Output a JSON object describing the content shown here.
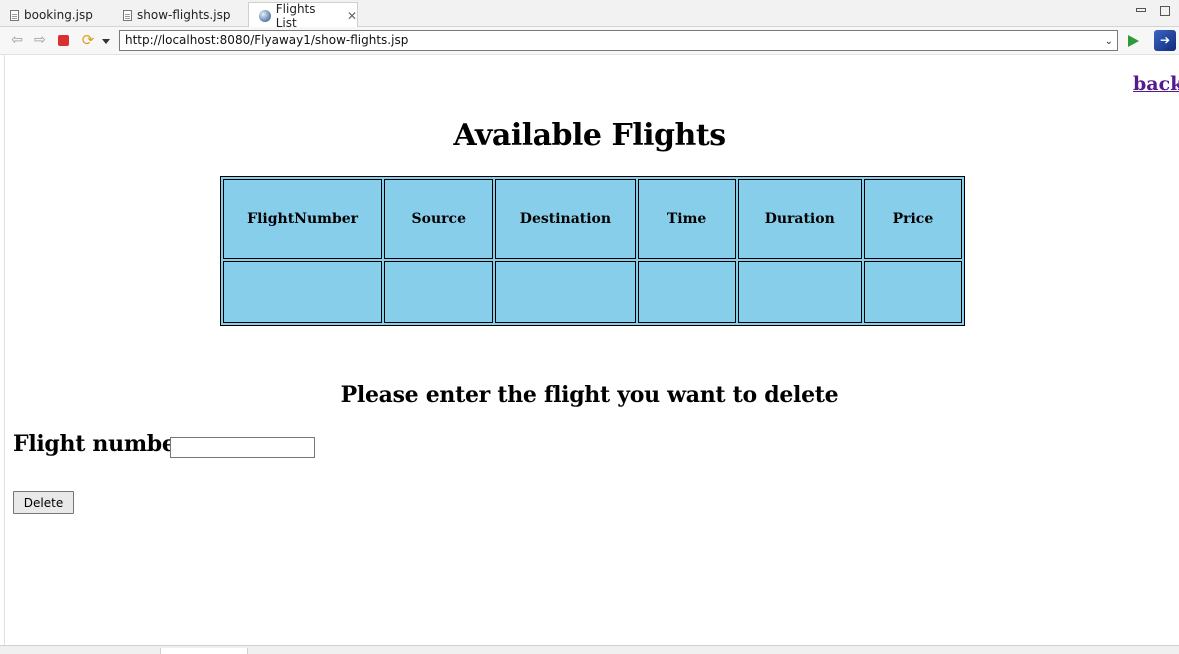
{
  "tabs": [
    {
      "label": "booking.jsp",
      "icon": "file-icon"
    },
    {
      "label": "show-flights.jsp",
      "icon": "file-icon"
    },
    {
      "label": "Flights List",
      "icon": "globe-icon",
      "active": true
    }
  ],
  "toolbar": {
    "url": "http://localhost:8080/Flyaway1/show-flights.jsp"
  },
  "page": {
    "back_link": "back",
    "title": "Available Flights",
    "table": {
      "headers": [
        "FlightNumber",
        "Source",
        "Destination",
        "Time",
        "Duration",
        "Price"
      ],
      "rows": [
        [
          "",
          "",
          "",
          "",
          "",
          ""
        ]
      ]
    },
    "delete_heading": "Please enter the flight you want to delete",
    "flight_label": "Flight number:",
    "flight_input_value": "",
    "delete_button": "Delete"
  },
  "colors": {
    "table_bg": "#87ceeb",
    "visited_link": "#551a8b"
  }
}
